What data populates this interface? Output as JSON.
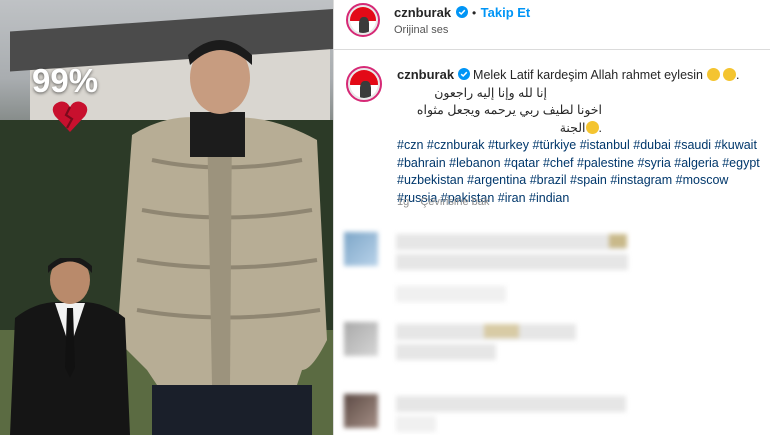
{
  "media": {
    "percent_text": "99%",
    "heart_icon": "broken-heart-icon",
    "heart_color": "#c8102e"
  },
  "header": {
    "username": "cznburak",
    "verified_icon": "verified-badge-icon",
    "separator": "•",
    "follow_label": "Takip Et",
    "audio_label": "Orijinal ses"
  },
  "post": {
    "username": "cznburak",
    "caption_line1": "Melek Latif kardeşim Allah rahmet eylesin",
    "caption_arabic1": "إنا لله وإنا إليه راجعون",
    "caption_arabic2": "اخونا لطيف ربي يرحمه ويجعل مثواه الجنة",
    "hashtags": "#czn #cznburak #turkey #türkiye #istanbul #dubai #saudi #kuwait #bahrain #lebanon #qatar #chef #palestine #syria #algeria #egypt #uzbekistan #argentina #brazil #spain #instagram #moscow #russia #pakistan #iran #indian",
    "time": "1g",
    "translate_label": "Çevirisine bak"
  },
  "colors": {
    "accent": "#0095f6",
    "hashtag": "#00376b",
    "ring": "#d62976"
  }
}
